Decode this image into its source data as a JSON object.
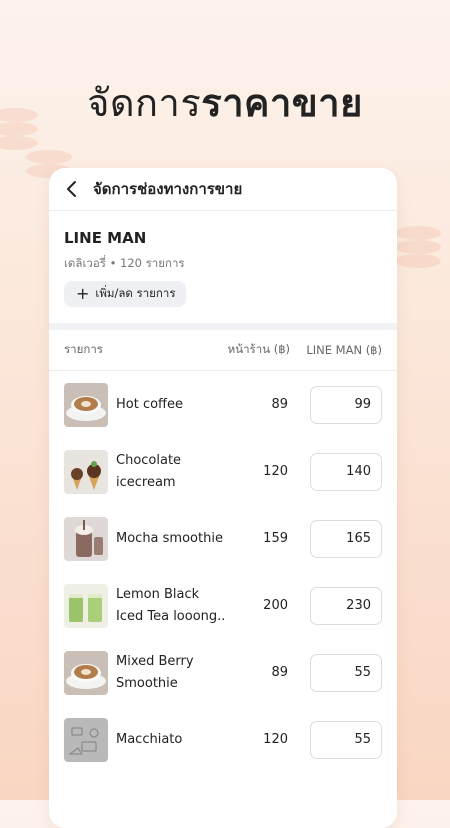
{
  "hero": {
    "title_regular": "จัดการ",
    "title_bold": "ราคาขาย"
  },
  "header": {
    "title": "จัดการช่องทางการขาย",
    "back_icon": "chevron-left-icon"
  },
  "store": {
    "name": "LINE MAN",
    "meta": "เดลิเวอรี่ • 120 รายการ",
    "add_button": "เพิ่ม/ลด รายการ",
    "add_icon": "plus-icon"
  },
  "table": {
    "headers": {
      "item": "รายการ",
      "store_price": "หน้าร้าน (฿)",
      "lineman_price": "LINE MAN (฿)"
    },
    "rows": [
      {
        "name": "Hot coffee",
        "store_price": "89",
        "lineman_price": "99",
        "image": "coffee-photo"
      },
      {
        "name": "Chocolate icecream",
        "store_price": "120",
        "lineman_price": "140",
        "image": "icecream-photo"
      },
      {
        "name": "Mocha smoothie",
        "store_price": "159",
        "lineman_price": "165",
        "image": "smoothie-photo"
      },
      {
        "name": "Lemon Black Iced Tea looong..",
        "store_price": "200",
        "lineman_price": "230",
        "image": "greentea-photo"
      },
      {
        "name": "Mixed Berry Smoothie",
        "store_price": "89",
        "lineman_price": "55",
        "image": "coffee-photo"
      },
      {
        "name": "Macchiato",
        "store_price": "120",
        "lineman_price": "55",
        "image": "placeholder-image"
      }
    ]
  },
  "colors": {
    "background_top": "#fdf3ec",
    "background_bottom": "#f9d6c2",
    "card": "#ffffff",
    "input_border": "#d9dce0"
  }
}
